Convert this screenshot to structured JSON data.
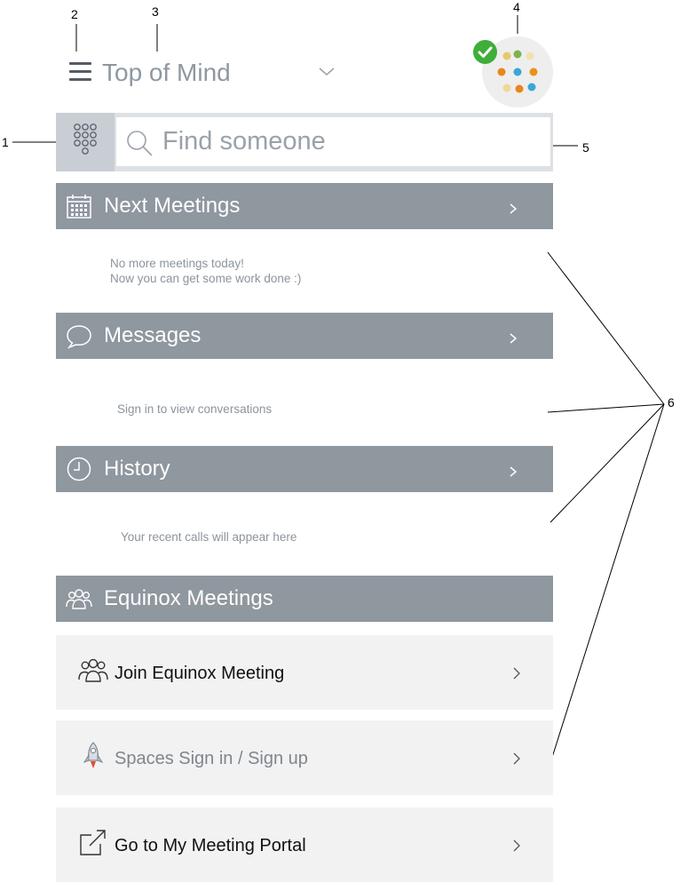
{
  "callouts": {
    "one": "1",
    "two": "2",
    "three": "3",
    "four": "4",
    "five": "5",
    "six": "6"
  },
  "header": {
    "title": "Top of Mind",
    "menu_icon": "hamburger-menu-icon",
    "dropdown_icon": "chevron-down-icon",
    "presence_status": "available",
    "status_color": "#3fae3a"
  },
  "search": {
    "placeholder": "Find someone",
    "dialpad_icon": "dialpad-icon",
    "search_icon": "search-icon"
  },
  "sections": {
    "next_meetings": {
      "title": "Next Meetings",
      "icon": "calendar-icon",
      "note_line1": "No more meetings today!",
      "note_line2": "Now you can get some work done :)"
    },
    "messages": {
      "title": "Messages",
      "icon": "speech-bubble-icon",
      "note": "Sign in to view conversations"
    },
    "history": {
      "title": "History",
      "icon": "clock-icon",
      "note": "Your recent calls will appear here"
    },
    "equinox": {
      "title": "Equinox Meetings",
      "icon": "people-group-icon"
    }
  },
  "rows": {
    "join": {
      "label": "Join Equinox Meeting",
      "icon": "people-group-icon"
    },
    "spaces": {
      "label": "Spaces Sign in / Sign up",
      "icon": "rocket-icon"
    },
    "portal": {
      "label": "Go to My Meeting Portal",
      "icon": "external-link-icon"
    }
  },
  "colors": {
    "section_header_bg": "#8f979f",
    "search_bar_bg": "#dde1e5",
    "row_bg": "#f2f2f2",
    "title_text": "#8e98a3"
  }
}
